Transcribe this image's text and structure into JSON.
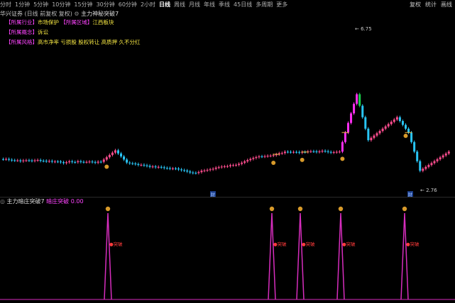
{
  "toolbar": {
    "items": [
      "分时",
      "1分钟",
      "5分钟",
      "10分钟",
      "15分钟",
      "30分钟",
      "60分钟",
      "2小时",
      "日线",
      "周线",
      "月线",
      "年线",
      "季线",
      "45日线",
      "多周期",
      "更多"
    ],
    "active": "日线",
    "right": [
      "复权",
      "统计",
      "画线"
    ]
  },
  "header": {
    "stock_name": "华兴证券",
    "adjust": "(日线 前复权 复权)",
    "indicator": "主力神秘突破7"
  },
  "info_lines": [
    {
      "tag": "【所属行业】",
      "value": "市场保护",
      "tag2": "【所属区域】",
      "value2": "江西板块"
    },
    {
      "tag": "【所属概念】",
      "value": "诉讼"
    },
    {
      "tag": "【所属风格】",
      "value": "高市净率 亏损股 股权转让 高质押 久不分红"
    }
  ],
  "price_labels": {
    "high": "6.75",
    "low": "2.76"
  },
  "bottom_marks": [
    "财",
    "财"
  ],
  "indicator_panel": {
    "name": "主力暗庄突破7",
    "subtitle": "暗庄突破",
    "value": "0.00",
    "signal_label": "突破"
  },
  "colors": {
    "up": "#ff4d8f",
    "down": "#29c5f6",
    "magenta": "#ff2ef2",
    "green": "#17d04a",
    "signal_line": "#d72dbe",
    "coin": "#d89a2a",
    "cross": "#f5c242",
    "tag": "#ff44ff",
    "text_yellow": "#f5e642"
  }
}
